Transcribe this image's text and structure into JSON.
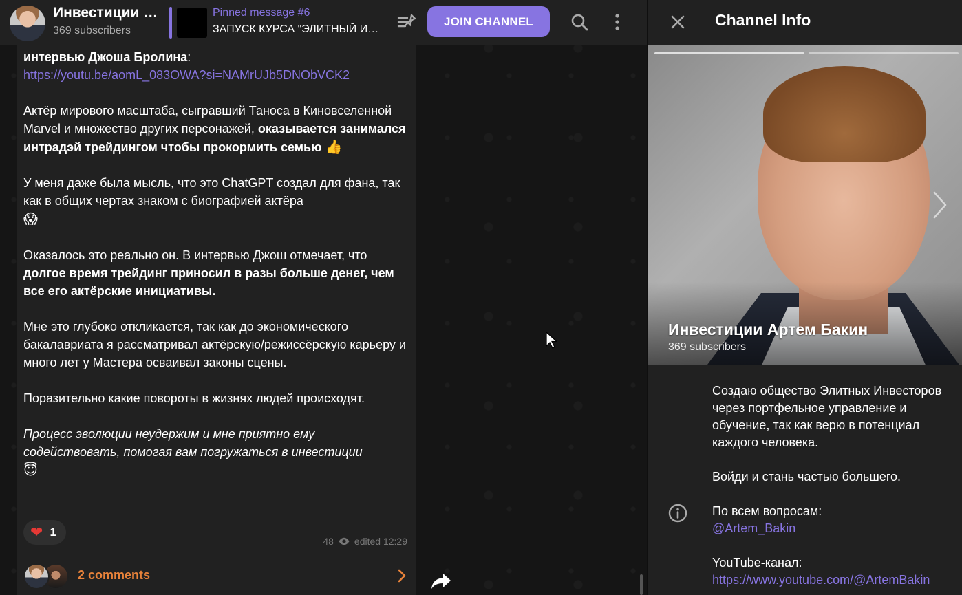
{
  "header": {
    "channel_title": "Инвестиции Артем Бакин",
    "subscribers": "369 subscribers",
    "pinned_label": "Pinned message #6",
    "pinned_text": "ЗАПУСК КУРСА \"ЭЛИТНЫЙ ИНВЕСТОР\"",
    "join_label": "JOIN CHANNEL",
    "accent_color": "#8774e1"
  },
  "message": {
    "line1_bold": "интервью Джоша Бролина",
    "line1_colon": ":",
    "link": "https://youtu.be/aomL_083OWA?si=NAMrUJb5DNObVCK2",
    "p2_text": "Актёр мирового масштаба, сыгравший Таноса в Киновселенной Marvel и множество других персонажей, ",
    "p2_bold": "оказывается занимался интрадэй трейдингом чтобы прокормить семью",
    "p2_emoji": "👍",
    "p3_text": "У меня даже была мысль, что это ChatGPT создал для фана, так как в общих чертах знаком с биографией актёра",
    "p3_emoji": "😱",
    "p4_text": "Оказалось это реально он. В интервью Джош отмечает, что ",
    "p4_bold": "долгое время трейдинг приносил в разы больше денег, чем все его актёрские инициативы.",
    "p5_text": "Мне это глубоко откликается, так как до экономического бакалавриата я рассматривал актёрскую/режиссёрскую карьеру и много лет у Мастера осваивал законы сцены.",
    "p6_text": "Поразительно какие повороты в жизнях людей происходят.",
    "p7_italic": "Процесс эволюции неудержим и мне приятно ему содействовать, помогая вам погружаться в инвестиции",
    "p7_emoji": "😇",
    "reaction_emoji": "❤",
    "reaction_count": "1",
    "views": "48",
    "edited": "edited 12:29",
    "comments_label": "2 comments"
  },
  "info": {
    "title": "Channel Info",
    "name": "Инвестиции Артем Бакин",
    "subscribers": "369 subscribers",
    "about_p1": "Создаю общество Элитных Инвесторов через портфельное управление и обучение, так как верю в потенциал каждого человека.",
    "about_p2": "Войди и стань частью большего.",
    "about_p3": "По всем вопросам:",
    "about_username": "@Artem_Bakin",
    "about_p4": "YouTube-канал:",
    "about_youtube": "https://www.youtube.com/@ArtemBakin"
  }
}
